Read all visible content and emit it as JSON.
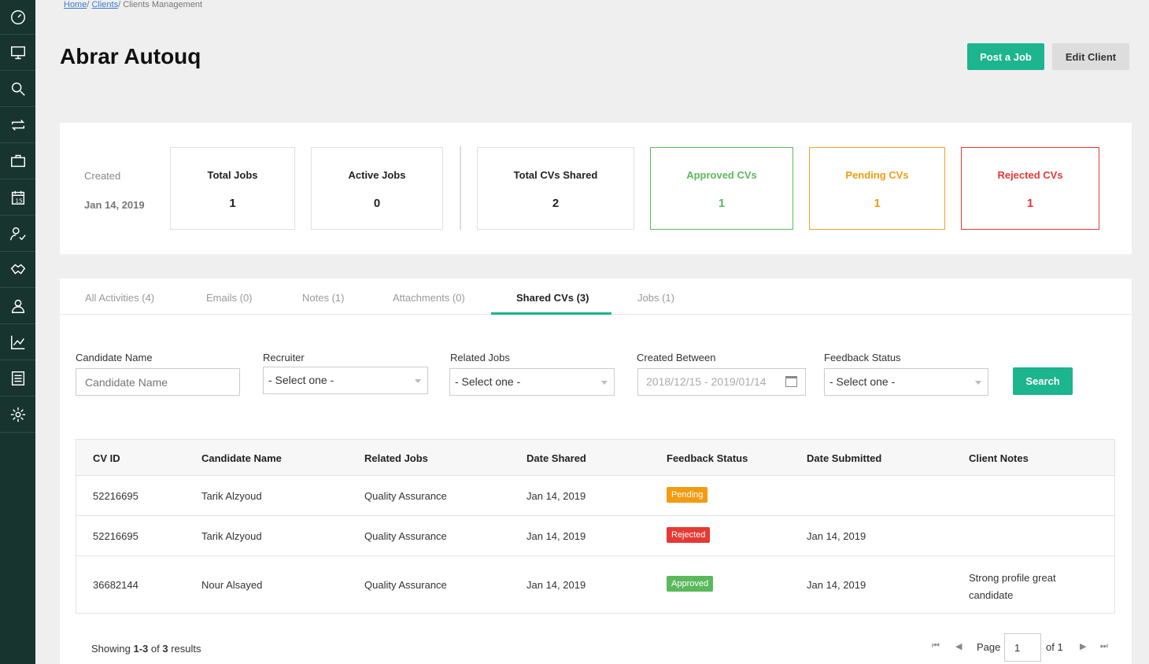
{
  "sidebar": {
    "items": [
      {
        "icon": "dashboard-icon"
      },
      {
        "icon": "monitor-icon"
      },
      {
        "icon": "search-icon"
      },
      {
        "icon": "repeat-icon"
      },
      {
        "icon": "briefcase-icon"
      },
      {
        "icon": "calendar-icon",
        "text": "15"
      },
      {
        "icon": "user-check-icon"
      },
      {
        "icon": "handshake-icon"
      },
      {
        "icon": "users-icon"
      },
      {
        "icon": "chart-icon"
      },
      {
        "icon": "list-icon"
      },
      {
        "icon": "gear-icon"
      }
    ]
  },
  "breadcrumb": {
    "home": "Home",
    "sep1": "/ ",
    "clients": "Clients",
    "sep2": "/ ",
    "current": "Clients Management"
  },
  "header": {
    "title": "Abrar Autouq",
    "post_job": "Post a Job",
    "edit_client": "Edit Client"
  },
  "stats": {
    "created_label": "Created",
    "created_date": "Jan 14, 2019",
    "total_jobs_label": "Total Jobs",
    "total_jobs": "1",
    "active_jobs_label": "Active Jobs",
    "active_jobs": "0",
    "total_cvs_label": "Total CVs Shared",
    "total_cvs": "2",
    "approved_label": "Approved CVs",
    "approved": "1",
    "pending_label": "Pending CVs",
    "pending": "1",
    "rejected_label": "Rejected CVs",
    "rejected": "1"
  },
  "tabs": [
    {
      "label": "All Activities (4)"
    },
    {
      "label": "Emails (0)"
    },
    {
      "label": "Notes (1)"
    },
    {
      "label": "Attachments (0)"
    },
    {
      "label": "Shared CVs (3)"
    },
    {
      "label": "Jobs (1)"
    }
  ],
  "filters": {
    "candidate_label": "Candidate Name",
    "candidate_placeholder": "Candidate Name",
    "recruiter_label": "Recruiter",
    "recruiter_value": "- Select one -",
    "jobs_label": "Related Jobs",
    "jobs_value": "- Select one -",
    "created_label": "Created Between",
    "created_value": "2018/12/15 - 2019/01/14",
    "feedback_label": "Feedback Status",
    "feedback_value": "- Select one -",
    "search": "Search"
  },
  "table": {
    "headers": [
      "CV ID",
      "Candidate Name",
      "Related Jobs",
      "Date Shared",
      "Feedback Status",
      "Date Submitted",
      "Client Notes"
    ],
    "rows": [
      {
        "cv_id": "52216695",
        "name": "Tarik Alzyoud",
        "job": "Quality Assurance",
        "shared": "Jan 14, 2019",
        "status": "Pending",
        "status_color": "#f39c12",
        "submitted": "",
        "notes1": "",
        "notes2": ""
      },
      {
        "cv_id": "52216695",
        "name": "Tarik Alzyoud",
        "job": "Quality Assurance",
        "shared": "Jan 14, 2019",
        "status": "Rejected",
        "status_color": "#e53935",
        "submitted": "Jan 14, 2019",
        "notes1": "",
        "notes2": ""
      },
      {
        "cv_id": "36682144",
        "name": "Nour Alsayed",
        "job": "Quality Assurance",
        "shared": "Jan 14, 2019",
        "status": "Approved",
        "status_color": "#5cb85c",
        "submitted": "Jan 14, 2019",
        "notes1": "Strong profile great",
        "notes2": "candidate"
      }
    ]
  },
  "footer": {
    "showing_prefix": "Showing ",
    "range": "1-3",
    "of": " of ",
    "total": "3",
    "suffix": " results",
    "page_label": "Page",
    "page_value": "1",
    "of_pages": "of 1"
  },
  "colors": {
    "accent": "#1cb58d",
    "sidebar": "#17342f",
    "approved": "#5cb85c",
    "pending": "#f39c12",
    "rejected": "#e53935"
  }
}
